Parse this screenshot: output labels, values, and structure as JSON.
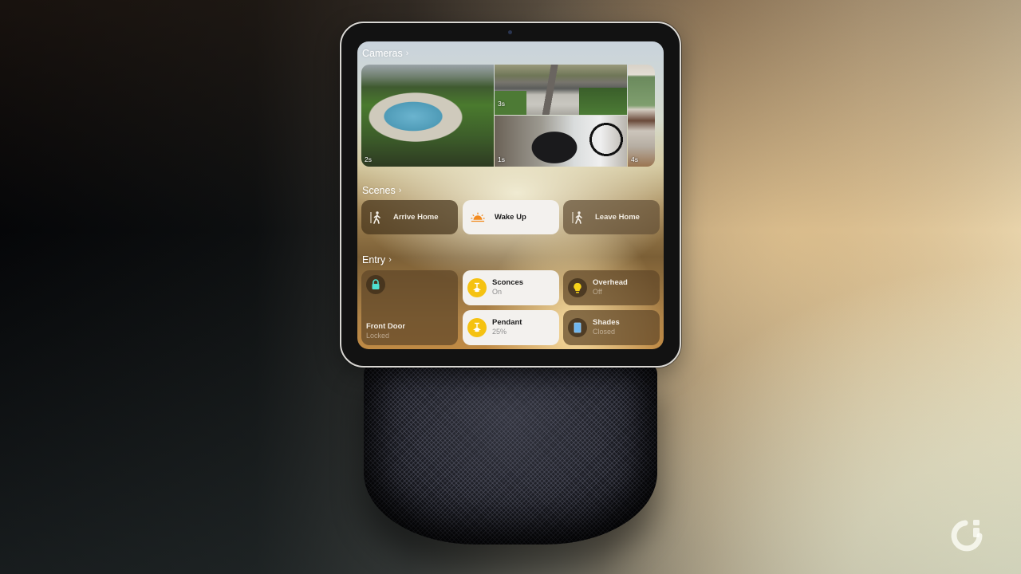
{
  "device": {
    "name": "Smart home display on speaker base"
  },
  "cameras": {
    "title": "Cameras",
    "chevron": "›",
    "feeds": [
      {
        "id": "pool",
        "label": "2s"
      },
      {
        "id": "street",
        "label": "3s"
      },
      {
        "id": "garage",
        "label": "1s"
      },
      {
        "id": "room",
        "label": "4s"
      }
    ]
  },
  "scenes": {
    "title": "Scenes",
    "chevron": "›",
    "items": [
      {
        "label": "Arrive Home",
        "icon": "walking-person-icon",
        "active": false
      },
      {
        "label": "Wake Up",
        "icon": "sunrise-icon",
        "active": true
      },
      {
        "label": "Leave Home",
        "icon": "walking-person-icon",
        "active": false
      }
    ]
  },
  "entry": {
    "title": "Entry",
    "chevron": "›",
    "accessories": [
      {
        "name": "Front Door",
        "state": "Locked",
        "icon": "lock-icon",
        "active": false
      },
      {
        "name": "Sconces",
        "state": "On",
        "icon": "pendant-light-icon",
        "active": true
      },
      {
        "name": "Overhead",
        "state": "Off",
        "icon": "lightbulb-icon",
        "active": false
      },
      {
        "name": "Pendant",
        "state": "25%",
        "icon": "pendant-light-icon",
        "active": true
      },
      {
        "name": "Shades",
        "state": "Closed",
        "icon": "window-shade-icon",
        "active": false
      }
    ]
  },
  "colors": {
    "accent_yellow": "#f5c211",
    "sunrise_orange": "#f28a1e",
    "lock_teal": "#4fe0d2",
    "shade_blue": "#6fb6ee",
    "bulb_yellow": "#f6d21a"
  }
}
